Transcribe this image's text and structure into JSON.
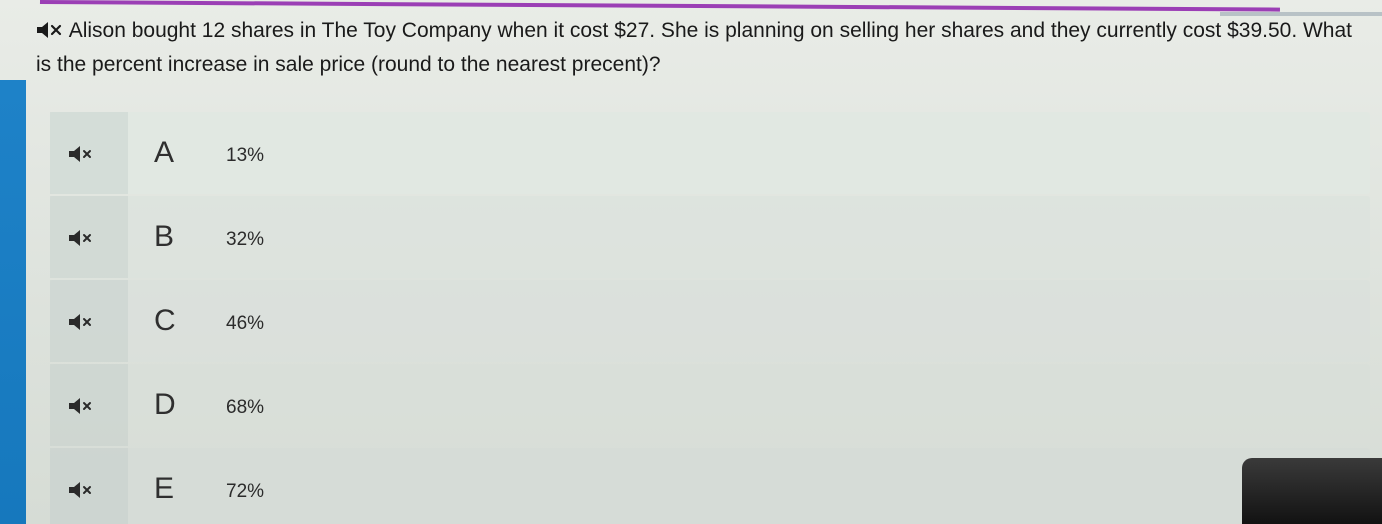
{
  "question": {
    "text": "Alison bought 12 shares in The Toy Company when it cost $27. She is planning on selling her shares and they currently cost $39.50. What is the percent increase in sale price (round to the nearest precent)?",
    "audio_icon": "speaker-mute-icon"
  },
  "options": [
    {
      "letter": "A",
      "value": "13%",
      "audio_icon": "speaker-mute-icon"
    },
    {
      "letter": "B",
      "value": "32%",
      "audio_icon": "speaker-mute-icon"
    },
    {
      "letter": "C",
      "value": "46%",
      "audio_icon": "speaker-mute-icon"
    },
    {
      "letter": "D",
      "value": "68%",
      "audio_icon": "speaker-mute-icon"
    },
    {
      "letter": "E",
      "value": "72%",
      "audio_icon": "speaker-mute-icon"
    }
  ],
  "colors": {
    "accent_bar": "#1e82c8",
    "top_rule": "#9b3fb5",
    "text": "#1a1a1a"
  }
}
